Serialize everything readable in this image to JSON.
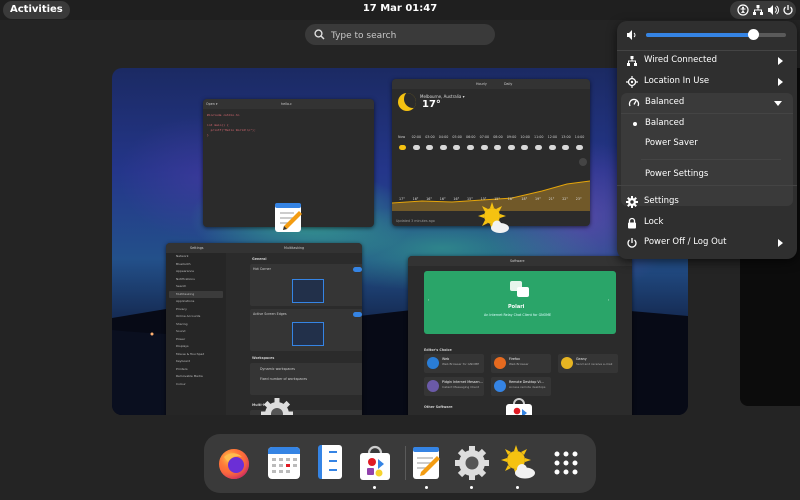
{
  "topbar": {
    "activities_label": "Activities",
    "clock": "17 Mar  01:47",
    "tray_icons": [
      "accessibility-icon",
      "network-wired-icon",
      "volume-icon",
      "power-icon"
    ]
  },
  "search": {
    "placeholder": "Type to search"
  },
  "windows": {
    "text_editor": {
      "open_label": "Open ▾",
      "title": "hello.c",
      "code_lines": [
        "#include <stdio.h>",
        "",
        "int main() {",
        "  printf(\"Hello World!\\n\");",
        "}"
      ]
    },
    "weather": {
      "location": "Melbourne, Australia ▾",
      "temp": "17°",
      "tabs": [
        "Hourly",
        "Daily"
      ],
      "hours": [
        "Now",
        "02:00",
        "03:00",
        "04:00",
        "05:00",
        "06:00",
        "07:00",
        "08:00",
        "09:00",
        "10:00",
        "11:00",
        "12:00",
        "13:00",
        "14:00"
      ],
      "temps": [
        "17°",
        "16°",
        "16°",
        "16°",
        "16°",
        "15°",
        "15°",
        "15°",
        "16°",
        "18°",
        "19°",
        "21°",
        "22°",
        "23°"
      ],
      "updated": "Updated 3 minutes ago"
    },
    "settings": {
      "sidebar_title": "Settings",
      "page_title": "Multitasking",
      "sidebar_items": [
        "Network",
        "Bluetooth",
        "Appearance",
        "Notifications",
        "Search",
        "Multitasking",
        "Applications",
        "Privacy",
        "Online Accounts",
        "Sharing",
        "Sound",
        "Power",
        "Displays",
        "Mouse & Touchpad",
        "Keyboard",
        "Printers",
        "Removable Media",
        "Colour"
      ],
      "section_general": "General",
      "hot_corner": "Hot Corner",
      "active_edges": "Active Screen Edges",
      "section_workspaces": "Workspaces",
      "dynamic_ws": "Dynamic workspaces",
      "fixed_ws": "Fixed number of workspaces",
      "multi_monitor": "Multi-Monitor"
    },
    "software": {
      "title": "Software",
      "hero_name": "Polari",
      "hero_desc": "An Internet Relay Chat Client for GNOME",
      "section_editors": "Editor's Choice",
      "section_other": "Other Software",
      "apps": [
        {
          "name": "Web",
          "desc": "Web Browser for GNOME",
          "color": "#2a7dd6"
        },
        {
          "name": "Firefox",
          "desc": "Web Browser",
          "color": "#e66a1f"
        },
        {
          "name": "Geany",
          "desc": "Send and receive e-mail",
          "color": "#e6b422"
        },
        {
          "name": "Pidgin Internet Messen…",
          "desc": "Instant Messaging Client",
          "color": "#6b5aa8"
        },
        {
          "name": "Remote Desktop Vi…",
          "desc": "Access remote desktops",
          "color": "#3584e4"
        }
      ]
    }
  },
  "dock": {
    "items": [
      {
        "name": "firefox-icon",
        "running": false
      },
      {
        "name": "calendar-icon",
        "running": false
      },
      {
        "name": "files-icon",
        "running": false
      },
      {
        "name": "software-icon",
        "running": true
      },
      {
        "name": "text-editor-icon",
        "running": true
      },
      {
        "name": "settings-gear-icon",
        "running": true
      },
      {
        "name": "weather-icon",
        "running": true
      },
      {
        "name": "app-grid-icon",
        "running": false
      }
    ]
  },
  "quick_menu": {
    "volume_fraction": 0.77,
    "wired": "Wired Connected",
    "location": "Location In Use",
    "power_mode": "Balanced",
    "power_options": [
      "Balanced",
      "Power Saver"
    ],
    "power_settings": "Power Settings",
    "settings": "Settings",
    "lock": "Lock",
    "power_off": "Power Off / Log Out",
    "accent_color": "#3584e4"
  }
}
